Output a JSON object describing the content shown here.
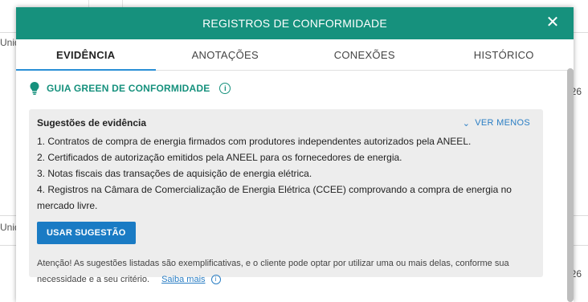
{
  "background": {
    "row_label_1": "Unid",
    "row_label_2": "Unid",
    "num_1": "26",
    "num_2": "26"
  },
  "modal": {
    "title": "REGISTROS DE CONFORMIDADE",
    "close_icon": "close-icon",
    "tabs": [
      {
        "label": "EVIDÊNCIA",
        "active": true
      },
      {
        "label": "ANOTAÇÕES",
        "active": false
      },
      {
        "label": "CONEXÕES",
        "active": false
      },
      {
        "label": "HISTÓRICO",
        "active": false
      }
    ],
    "guide": {
      "title": "GUIA GREEN DE CONFORMIDADE",
      "icon": "lightbulb-icon",
      "info_icon": "info-icon"
    },
    "suggestions": {
      "title": "Sugestões de evidência",
      "toggle_label": "VER MENOS",
      "items": [
        "1. Contratos de compra de energia firmados com produtores independentes autorizados pela ANEEL.",
        "2. Certificados de autorização emitidos pela ANEEL para os fornecedores de energia.",
        "3. Notas fiscais das transações de aquisição de energia elétrica.",
        "4. Registros na Câmara de Comercialização de Energia Elétrica (CCEE) comprovando a compra de energia no mercado livre."
      ],
      "use_button": "USAR SUGESTÃO",
      "notice": "Atenção! As sugestões listadas são exemplificativas, e o cliente pode optar por utilizar uma ou mais delas, conforme sua necessidade e a seu critério.",
      "learn_more": "Saiba mais"
    },
    "colors": {
      "header": "#16917d",
      "accent_tab": "#2a8fd6",
      "button": "#1a7bc4"
    }
  }
}
